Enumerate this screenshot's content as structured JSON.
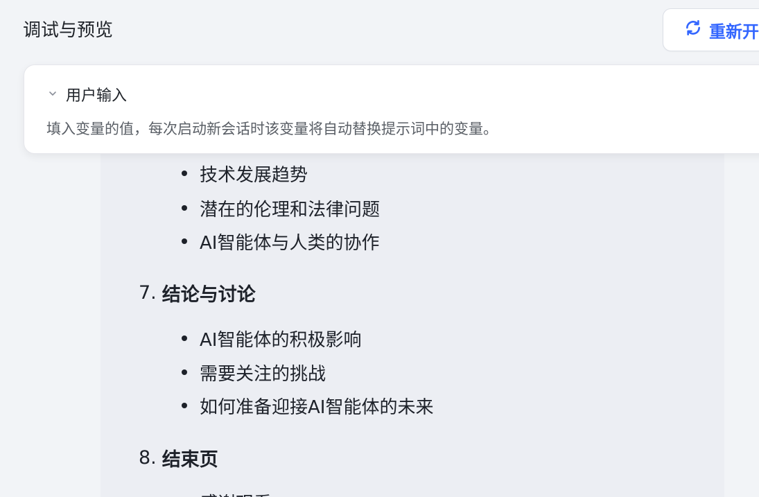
{
  "header": {
    "title": "调试与预览",
    "restart_label": "重新开"
  },
  "user_input": {
    "title": "用户输入",
    "description": "填入变量的值，每次启动新会话时该变量将自动替换提示词中的变量。"
  },
  "message": {
    "section6_items": [
      "技术发展趋势",
      "潜在的伦理和法律问题",
      "AI智能体与人类的协作"
    ],
    "section7": {
      "number": "7.",
      "title": "结论与讨论",
      "items": [
        "AI智能体的积极影响",
        "需要关注的挑战",
        "如何准备迎接AI智能体的未来"
      ]
    },
    "section8": {
      "number": "8.",
      "title": "结束页",
      "partial_item": "感谢观看"
    }
  },
  "colors": {
    "accent": "#3366ff",
    "background": "#f2f4f7",
    "chat_bg": "#eceef3"
  },
  "icons": {
    "restart": "refresh-icon",
    "collapse": "chevron-down-icon"
  }
}
